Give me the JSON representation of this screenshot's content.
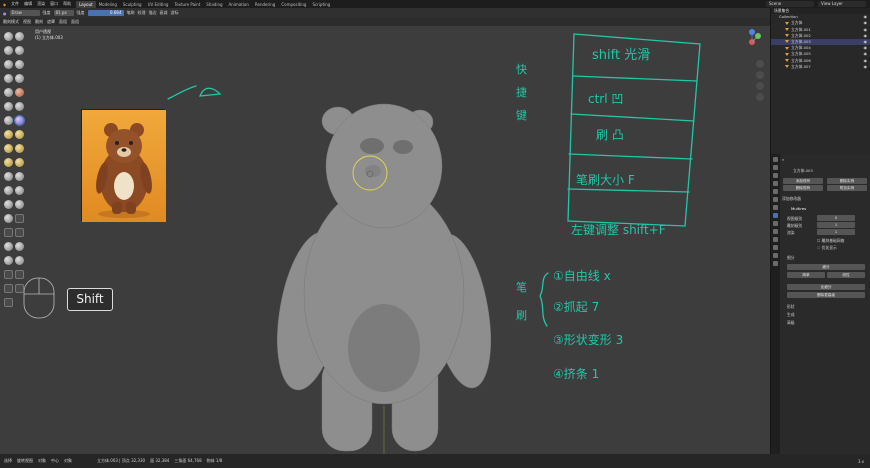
{
  "menu": {
    "items": [
      "文件",
      "编辑",
      "渲染",
      "窗口",
      "帮助"
    ],
    "workspaces": [
      "Layout",
      "Modeling",
      "Sculpting",
      "UV Editing",
      "Texture Paint",
      "Shading",
      "Animation",
      "Rendering",
      "Compositing",
      "Scripting"
    ],
    "active_workspace": "Layout",
    "scene_label": "Scene",
    "view_layer_label": "View Layer"
  },
  "toolbar": {
    "brush_name": "Draw",
    "strength_label": "强度",
    "radius_value": "81 px",
    "radius_label": "强度",
    "strength_value": "0.664",
    "menus": [
      "笔刷",
      "纹理",
      "描边",
      "衰减",
      "游标"
    ]
  },
  "header2": {
    "mode": "雕刻模式",
    "menus": [
      "视图",
      "雕刻",
      "遮罩",
      "面组",
      "面组"
    ]
  },
  "viewport": {
    "view_name": "用户透视",
    "object_name": "(1) 立方体.003"
  },
  "overlay_key": "Shift",
  "handwriting": {
    "left_vertical": "快 捷 键",
    "table": [
      "shift 光滑",
      "ctrl 凹",
      "刷 凸",
      "笔刷大小 F",
      "左键调整 shift+F"
    ],
    "brush_label": "笔 刷",
    "list": [
      "①自由线 x",
      "②抓起 7",
      "③形状变形 3",
      "④挤条 1"
    ]
  },
  "outliner": {
    "header": "场景集合",
    "collection": "Collection",
    "rows": [
      "立方体",
      "立方体.001",
      "立方体.002",
      "立方体.003",
      "立方体.004",
      "立方体.005",
      "立方体.006",
      "立方体.007"
    ],
    "selected_index": 3
  },
  "properties": {
    "object": "立方体.003",
    "buttons_top": [
      "添加现有",
      "删除实例",
      "删除现有",
      "附加实例"
    ],
    "modifier_add_label": "添加修改器",
    "modifier_name": "Multires",
    "fields": [
      {
        "label": "视图级别",
        "value": "0"
      },
      {
        "label": "雕刻级别",
        "value": "1"
      },
      {
        "label": "渲染",
        "value": "1"
      }
    ],
    "checkboxes": [
      "雕刻基础网格",
      "优化显示"
    ],
    "section_subdiv": "细分",
    "subdiv_buttons": [
      "细分",
      "简单",
      "线性"
    ],
    "buttons_bottom": [
      "反细分",
      "删除更高级"
    ],
    "sections": [
      "形状",
      "生成",
      "高级"
    ]
  },
  "status": {
    "items": [
      "选择",
      "旋转视图",
      "对象",
      "中心",
      "对象",
      "立方体.003 | 顶点 32,330",
      "面 32,384",
      "三角面 64,768",
      "物体 1/8"
    ],
    "version": "3.x"
  },
  "colors": {
    "background": "#3d3d3d",
    "handwriting": "#22c7a9",
    "selection": "#4772b3",
    "brush_circle": "#e8d84a"
  }
}
